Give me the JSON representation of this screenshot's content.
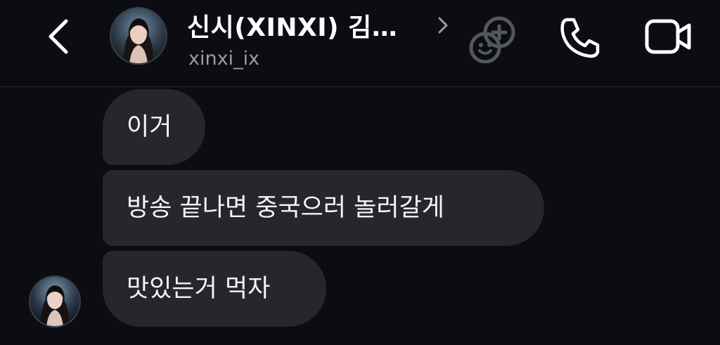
{
  "header": {
    "contact_name": "신시(XINXI) 김…",
    "username": "xinxi_ix",
    "icons": {
      "back": "chevron-left-icon",
      "details": "chevron-right-icon",
      "games": "games-icon",
      "call": "phone-icon",
      "video": "video-camera-icon"
    }
  },
  "messages": [
    {
      "text": "이거"
    },
    {
      "text": "방송 끝나면 중국으러 놀러갈게"
    },
    {
      "text": "맛있는거 먹자"
    }
  ],
  "colors": {
    "background": "#0c0d12",
    "bubble": "#25272d",
    "text": "#f4f4f6",
    "secondary_text": "#9a9ca3"
  }
}
